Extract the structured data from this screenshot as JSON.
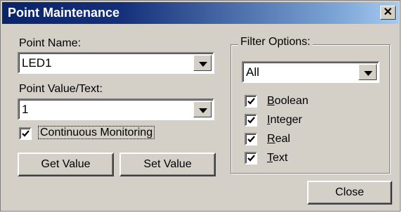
{
  "window": {
    "title": "Point Maintenance",
    "close_glyph": "✕"
  },
  "point_name": {
    "label": "Point Name:",
    "value": "LED1"
  },
  "point_value": {
    "label": "Point Value/Text:",
    "value": "1"
  },
  "continuous_monitoring": {
    "label": "Continuous Monitoring",
    "checked": true
  },
  "buttons": {
    "get_value": "Get Value",
    "set_value": "Set Value",
    "close": "Close"
  },
  "filter": {
    "title": "Filter Options:",
    "selected": "All",
    "options": [
      {
        "first": "B",
        "rest": "oolean",
        "checked": true
      },
      {
        "first": "I",
        "rest": "nteger",
        "checked": true
      },
      {
        "first": "R",
        "rest": "eal",
        "checked": true
      },
      {
        "first": "T",
        "rest": "ext",
        "checked": true
      }
    ]
  },
  "colors": {
    "dialog_bg": "#d4d0c8",
    "title_start": "#0a246a",
    "title_end": "#a6caf0"
  }
}
